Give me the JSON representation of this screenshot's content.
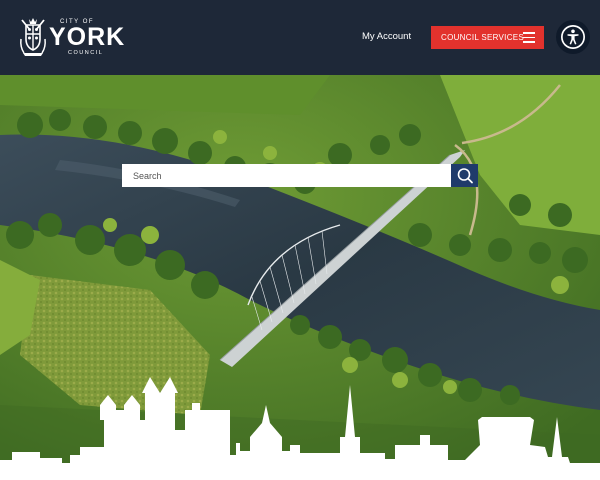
{
  "header": {
    "logo": {
      "city_of": "CITY OF",
      "name": "YORK",
      "council": "COUNCIL",
      "crest_icon": "coat-of-arms-icon"
    },
    "my_account_label": "My Account",
    "services_button_label": "COUNCIL SERVICES",
    "services_icon": "hamburger-menu-icon",
    "accessibility_icon": "accessibility-person-icon"
  },
  "search": {
    "placeholder": "Search",
    "value": "",
    "button_icon": "search-icon"
  },
  "hero": {
    "image": "aerial-photo-river-ouse-millennium-bridge",
    "skyline": "york-skyline-silhouette"
  },
  "colors": {
    "header_bg": "#1e2838",
    "accent_red": "#e2322d",
    "search_button": "#1f3b6b",
    "river": "#2e3d48",
    "grass": "#5c8d2a"
  }
}
